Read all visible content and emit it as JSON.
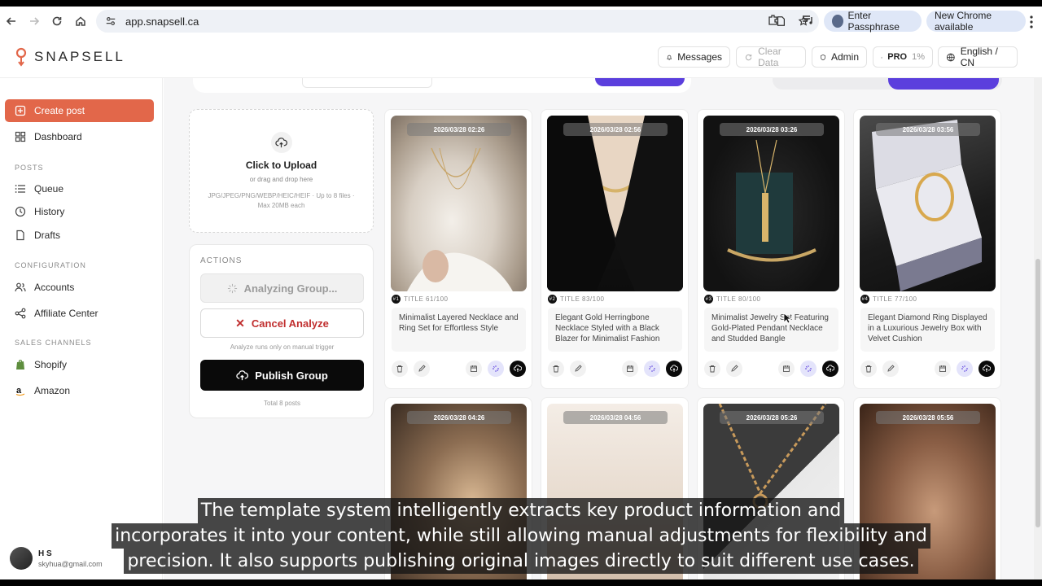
{
  "browser": {
    "url": "app.snapsell.ca",
    "passphrase_label": "Enter Passphrase",
    "chrome_label": "New Chrome available"
  },
  "header": {
    "logo_text": "SNAPSELL",
    "messages": "Messages",
    "clear_data": "Clear Data",
    "admin": "Admin",
    "pro": "PRO",
    "pro_pct": "1%",
    "language": "English / CN"
  },
  "sidebar": {
    "create_post": "Create post",
    "dashboard": "Dashboard",
    "posts_section": "POSTS",
    "queue": "Queue",
    "history": "History",
    "drafts": "Drafts",
    "config_section": "CONFIGURATION",
    "accounts": "Accounts",
    "affiliate": "Affiliate Center",
    "channels_section": "SALES CHANNELS",
    "shopify": "Shopify",
    "amazon": "Amazon",
    "user_name": "H S",
    "user_email": "skyhua@gmail.com"
  },
  "upload": {
    "title": "Click to Upload",
    "sub": "or drag and drop here",
    "formats_1": "JPG/JPEG/PNG/WEBP/HEIC/HEIF · Up to 8 files ·",
    "formats_2": "Max 20MB each"
  },
  "actions": {
    "title": "ACTIONS",
    "analyzing": "Analyzing Group...",
    "cancel": "Cancel Analyze",
    "note": "Analyze runs only on manual trigger",
    "publish": "Publish Group",
    "total": "Total 8 posts"
  },
  "cards": [
    {
      "time": "2026/03/28 02:26",
      "num": "#1",
      "score": "TITLE 61/100",
      "text": "Minimalist Layered Necklace and Ring Set for Effortless Style"
    },
    {
      "time": "2026/03/28 02:56",
      "num": "#2",
      "score": "TITLE 83/100",
      "text": "Elegant Gold Herringbone Necklace Styled with a Black Blazer for Minimalist Fashion"
    },
    {
      "time": "2026/03/28 03:26",
      "num": "#3",
      "score": "TITLE 80/100",
      "text": "Minimalist Jewelry Set Featuring Gold-Plated Pendant Necklace and Studded Bangle"
    },
    {
      "time": "2026/03/28 03:56",
      "num": "#4",
      "score": "TITLE 77/100",
      "text": "Elegant Diamond Ring Displayed in a Luxurious Jewelry Box with Velvet Cushion"
    },
    {
      "time": "2026/03/28 04:26"
    },
    {
      "time": "2026/03/28 04:56"
    },
    {
      "time": "2026/03/28 05:26"
    },
    {
      "time": "2026/03/28 05:56"
    }
  ],
  "subtitles": [
    "The template system intelligently extracts key product information and",
    "incorporates it into your content, while still allowing manual adjustments for flexibility and",
    "precision. It also supports publishing original images directly to suit different use cases."
  ],
  "colors": {
    "accent": "#e2674a",
    "primary_purple": "#5b3fdd",
    "cancel_red": "#c02e2e"
  }
}
